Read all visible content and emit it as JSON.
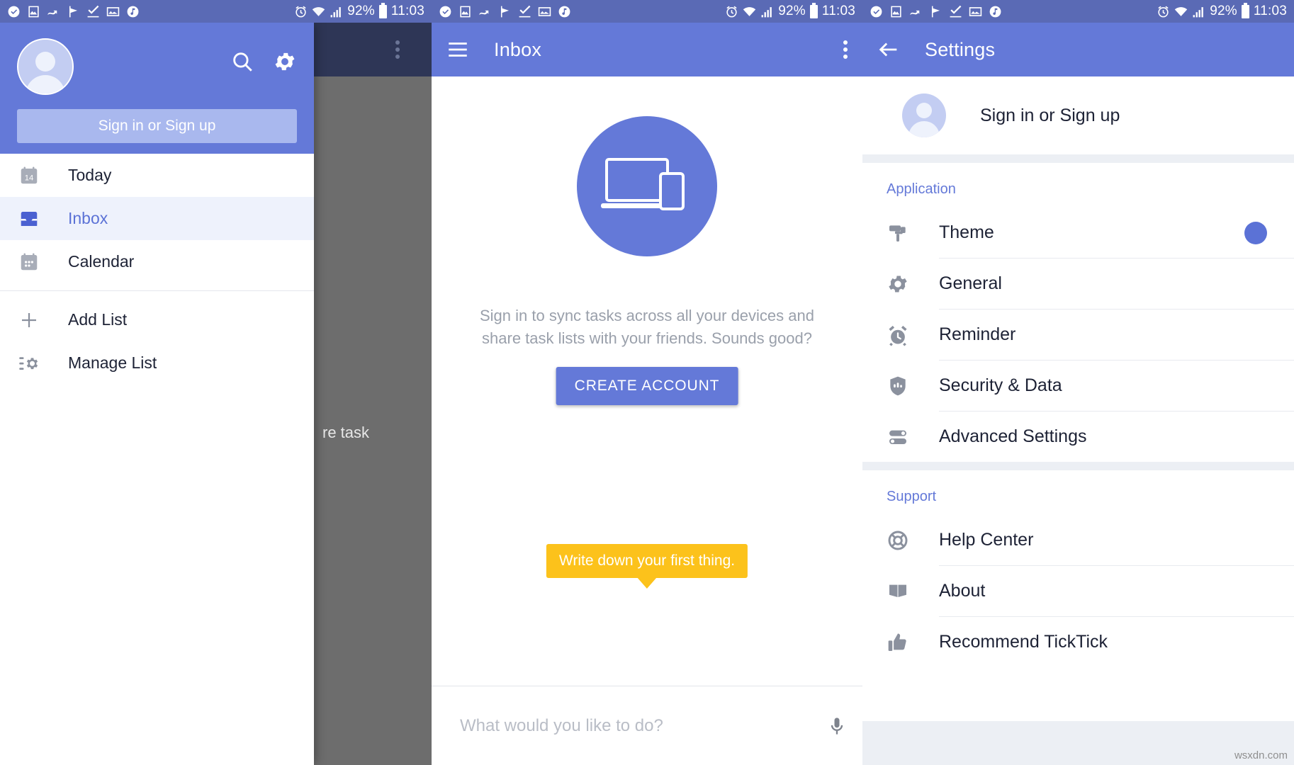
{
  "status_bar": {
    "notification_icons": [
      "check-circle-icon",
      "image-icon",
      "sync-icon",
      "flag-icon",
      "check-mark-icon",
      "photo-icon",
      "music-note-icon"
    ],
    "alarm_icon": "alarm-icon",
    "wifi_icon": "wifi-icon",
    "signal_icon": "signal-icon",
    "battery_percent": "92%",
    "battery_icon": "battery-icon",
    "clock": "11:03"
  },
  "drawer": {
    "avatar": "user-avatar",
    "search_icon": "search-icon",
    "settings_icon": "gear-icon",
    "sign_in_label": "Sign in or Sign up",
    "items": [
      {
        "label": "Today",
        "icon": "calendar-today-icon",
        "badge": "14",
        "active": false
      },
      {
        "label": "Inbox",
        "icon": "inbox-icon",
        "active": true
      },
      {
        "label": "Calendar",
        "icon": "calendar-icon",
        "active": false
      }
    ],
    "actions": [
      {
        "label": "Add List",
        "icon": "plus-icon"
      },
      {
        "label": "Manage List",
        "icon": "manage-list-icon"
      }
    ],
    "dim_task_text": "re task",
    "overflow_icon": "more-vertical-icon"
  },
  "inbox": {
    "menu_icon": "hamburger-menu-icon",
    "title": "Inbox",
    "overflow_icon": "more-vertical-icon",
    "hero_icon": "devices-icon",
    "description": "Sign in to sync tasks across all your devices and share task lists with your friends. Sounds good?",
    "cta_label": "CREATE ACCOUNT",
    "tooltip": "Write down your first thing.",
    "input_placeholder": "What would you like to do?",
    "mic_icon": "microphone-icon"
  },
  "settings": {
    "back_icon": "arrow-left-icon",
    "title": "Settings",
    "account_label": "Sign in or Sign up",
    "account_avatar": "user-avatar",
    "sections": [
      {
        "title": "Application",
        "items": [
          {
            "label": "Theme",
            "icon": "paint-roller-icon",
            "accent": "#5b72d6"
          },
          {
            "label": "General",
            "icon": "gear-icon"
          },
          {
            "label": "Reminder",
            "icon": "alarm-clock-icon"
          },
          {
            "label": "Security & Data",
            "icon": "shield-icon"
          },
          {
            "label": "Advanced Settings",
            "icon": "toggles-icon"
          }
        ]
      },
      {
        "title": "Support",
        "items": [
          {
            "label": "Help Center",
            "icon": "life-ring-icon"
          },
          {
            "label": "About",
            "icon": "book-icon"
          },
          {
            "label": "Recommend TickTick",
            "icon": "thumbs-up-icon"
          }
        ]
      }
    ]
  },
  "colors": {
    "primary": "#6479d8",
    "status_bar": "#5a6ab5",
    "accent": "#5b72d6",
    "tooltip": "#fcc21b"
  },
  "watermark": "wsxdn.com"
}
